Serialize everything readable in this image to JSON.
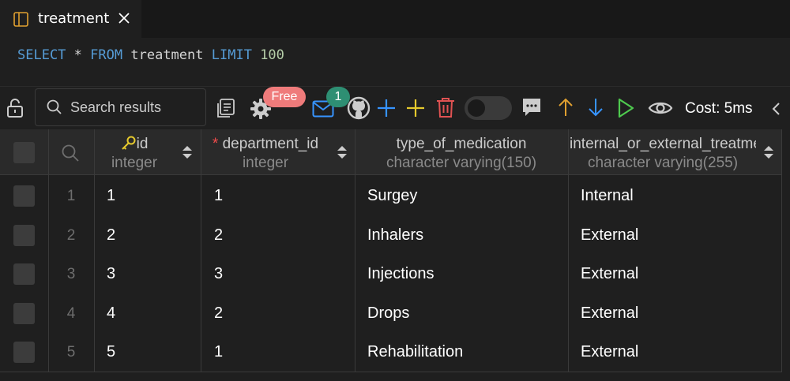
{
  "tab": {
    "title": "treatment",
    "icon": "table-icon"
  },
  "editor": {
    "sql": {
      "kw1": "SELECT",
      "star": "*",
      "kw2": "FROM",
      "table": "treatment",
      "kw3": "LIMIT",
      "limit": "100"
    }
  },
  "toolbar": {
    "search_placeholder": "Search results",
    "free_badge": "Free",
    "notification_count": "1",
    "cost": "Cost: 5ms"
  },
  "grid": {
    "columns": [
      {
        "name": "id",
        "type": "integer",
        "icon": "key-icon"
      },
      {
        "name": "department_id",
        "type": "integer",
        "required_marker": "*"
      },
      {
        "name": "type_of_medication",
        "type": "character varying(150)"
      },
      {
        "name": "internal_or_external_treatment",
        "type": "character varying(255)"
      }
    ],
    "rows": [
      {
        "n": "1",
        "id": "1",
        "department_id": "1",
        "type_of_medication": "Surgey",
        "internal_or_external": "Internal"
      },
      {
        "n": "2",
        "id": "2",
        "department_id": "2",
        "type_of_medication": "Inhalers",
        "internal_or_external": "External"
      },
      {
        "n": "3",
        "id": "3",
        "department_id": "3",
        "type_of_medication": "Injections",
        "internal_or_external": "External"
      },
      {
        "n": "4",
        "id": "4",
        "department_id": "2",
        "type_of_medication": "Drops",
        "internal_or_external": "External"
      },
      {
        "n": "5",
        "id": "5",
        "department_id": "1",
        "type_of_medication": "Rehabilitation",
        "internal_or_external": "External"
      }
    ]
  },
  "colors": {
    "accent_blue": "#569cd6",
    "add_blue": "#3794ff",
    "add_yellow": "#e5c92d",
    "delete_red": "#e05252",
    "up_yellow": "#e0a030",
    "run_green": "#4ec94e",
    "key_yellow": "#e5c92d",
    "required_red": "#f14c4c"
  }
}
